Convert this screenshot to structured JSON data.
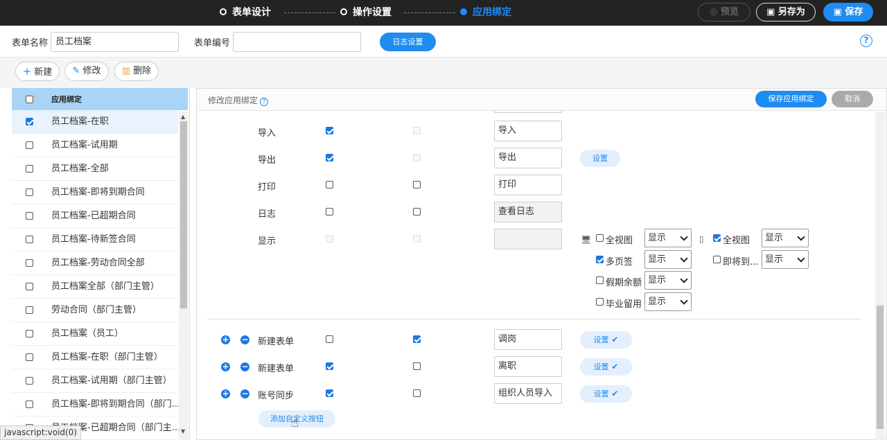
{
  "topbar": {
    "steps": [
      "表单设计",
      "操作设置",
      "应用绑定"
    ],
    "preview": "预览",
    "saveas": "另存为",
    "save": "保存"
  },
  "form": {
    "name_label": "表单名称",
    "name_value": "员工档案",
    "code_label": "表单编号",
    "code_value": "",
    "log_button": "日志设置"
  },
  "actions": {
    "new": "新建",
    "edit": "修改",
    "delete": "删除"
  },
  "list": {
    "header": "应用绑定",
    "items": [
      "员工档案-在职",
      "员工档案-试用期",
      "员工档案-全部",
      "员工档案-即将到期合同",
      "员工档案-已超期合同",
      "员工档案-待新签合同",
      "员工档案-劳动合同全部",
      "员工档案全部（部门主管）",
      "劳动合同（部门主管）",
      "员工档案（员工）",
      "员工档案-在职（部门主管）",
      "员工档案-试用期（部门主管）",
      "员工档案-即将到期合同（部门...",
      "员工档案-已超期合同（部门主..."
    ],
    "selected_index": 0
  },
  "status_text": "javascript:void(0)",
  "right": {
    "title": "修改应用绑定",
    "save_binding": "保存应用绑定",
    "cancel": "取消",
    "rows": [
      {
        "label": "导入",
        "col1": "checked",
        "col2": "disabled",
        "text": "导入",
        "readonly": false,
        "set": ""
      },
      {
        "label": "导出",
        "col1": "checked",
        "col2": "disabled",
        "text": "导出",
        "readonly": false,
        "set": "设置"
      },
      {
        "label": "打印",
        "col1": "unchecked",
        "col2": "unchecked",
        "text": "打印",
        "readonly": false,
        "set": ""
      },
      {
        "label": "日志",
        "col1": "unchecked",
        "col2": "unchecked",
        "text": "查看日志",
        "readonly": true,
        "set": ""
      },
      {
        "label": "显示",
        "col1": "disabled",
        "col2": "disabled",
        "text": "",
        "readonly": true,
        "set": ""
      }
    ],
    "display_options": {
      "pc": [
        {
          "label": "全视图",
          "checked": false,
          "value": "显示"
        },
        {
          "label": "多页签",
          "checked": true,
          "value": "显示"
        },
        {
          "label": "假期余额",
          "checked": false,
          "value": "显示"
        },
        {
          "label": "毕业留用",
          "checked": false,
          "value": "显示"
        }
      ],
      "mobile": [
        {
          "label": "全视图",
          "checked": true,
          "value": "显示"
        },
        {
          "label": "即将到...",
          "checked": false,
          "value": "显示"
        }
      ]
    },
    "custom_rows": [
      {
        "label": "新建表单",
        "col1": "unchecked",
        "col2": "checked",
        "text": "调岗",
        "set": "设置"
      },
      {
        "label": "新建表单",
        "col1": "checked",
        "col2": "unchecked",
        "text": "离职",
        "set": "设置"
      },
      {
        "label": "账号同步",
        "col1": "checked",
        "col2": "unchecked",
        "text": "组织人员导入",
        "set": "设置"
      }
    ],
    "add_custom": "添加自定义按钮"
  }
}
